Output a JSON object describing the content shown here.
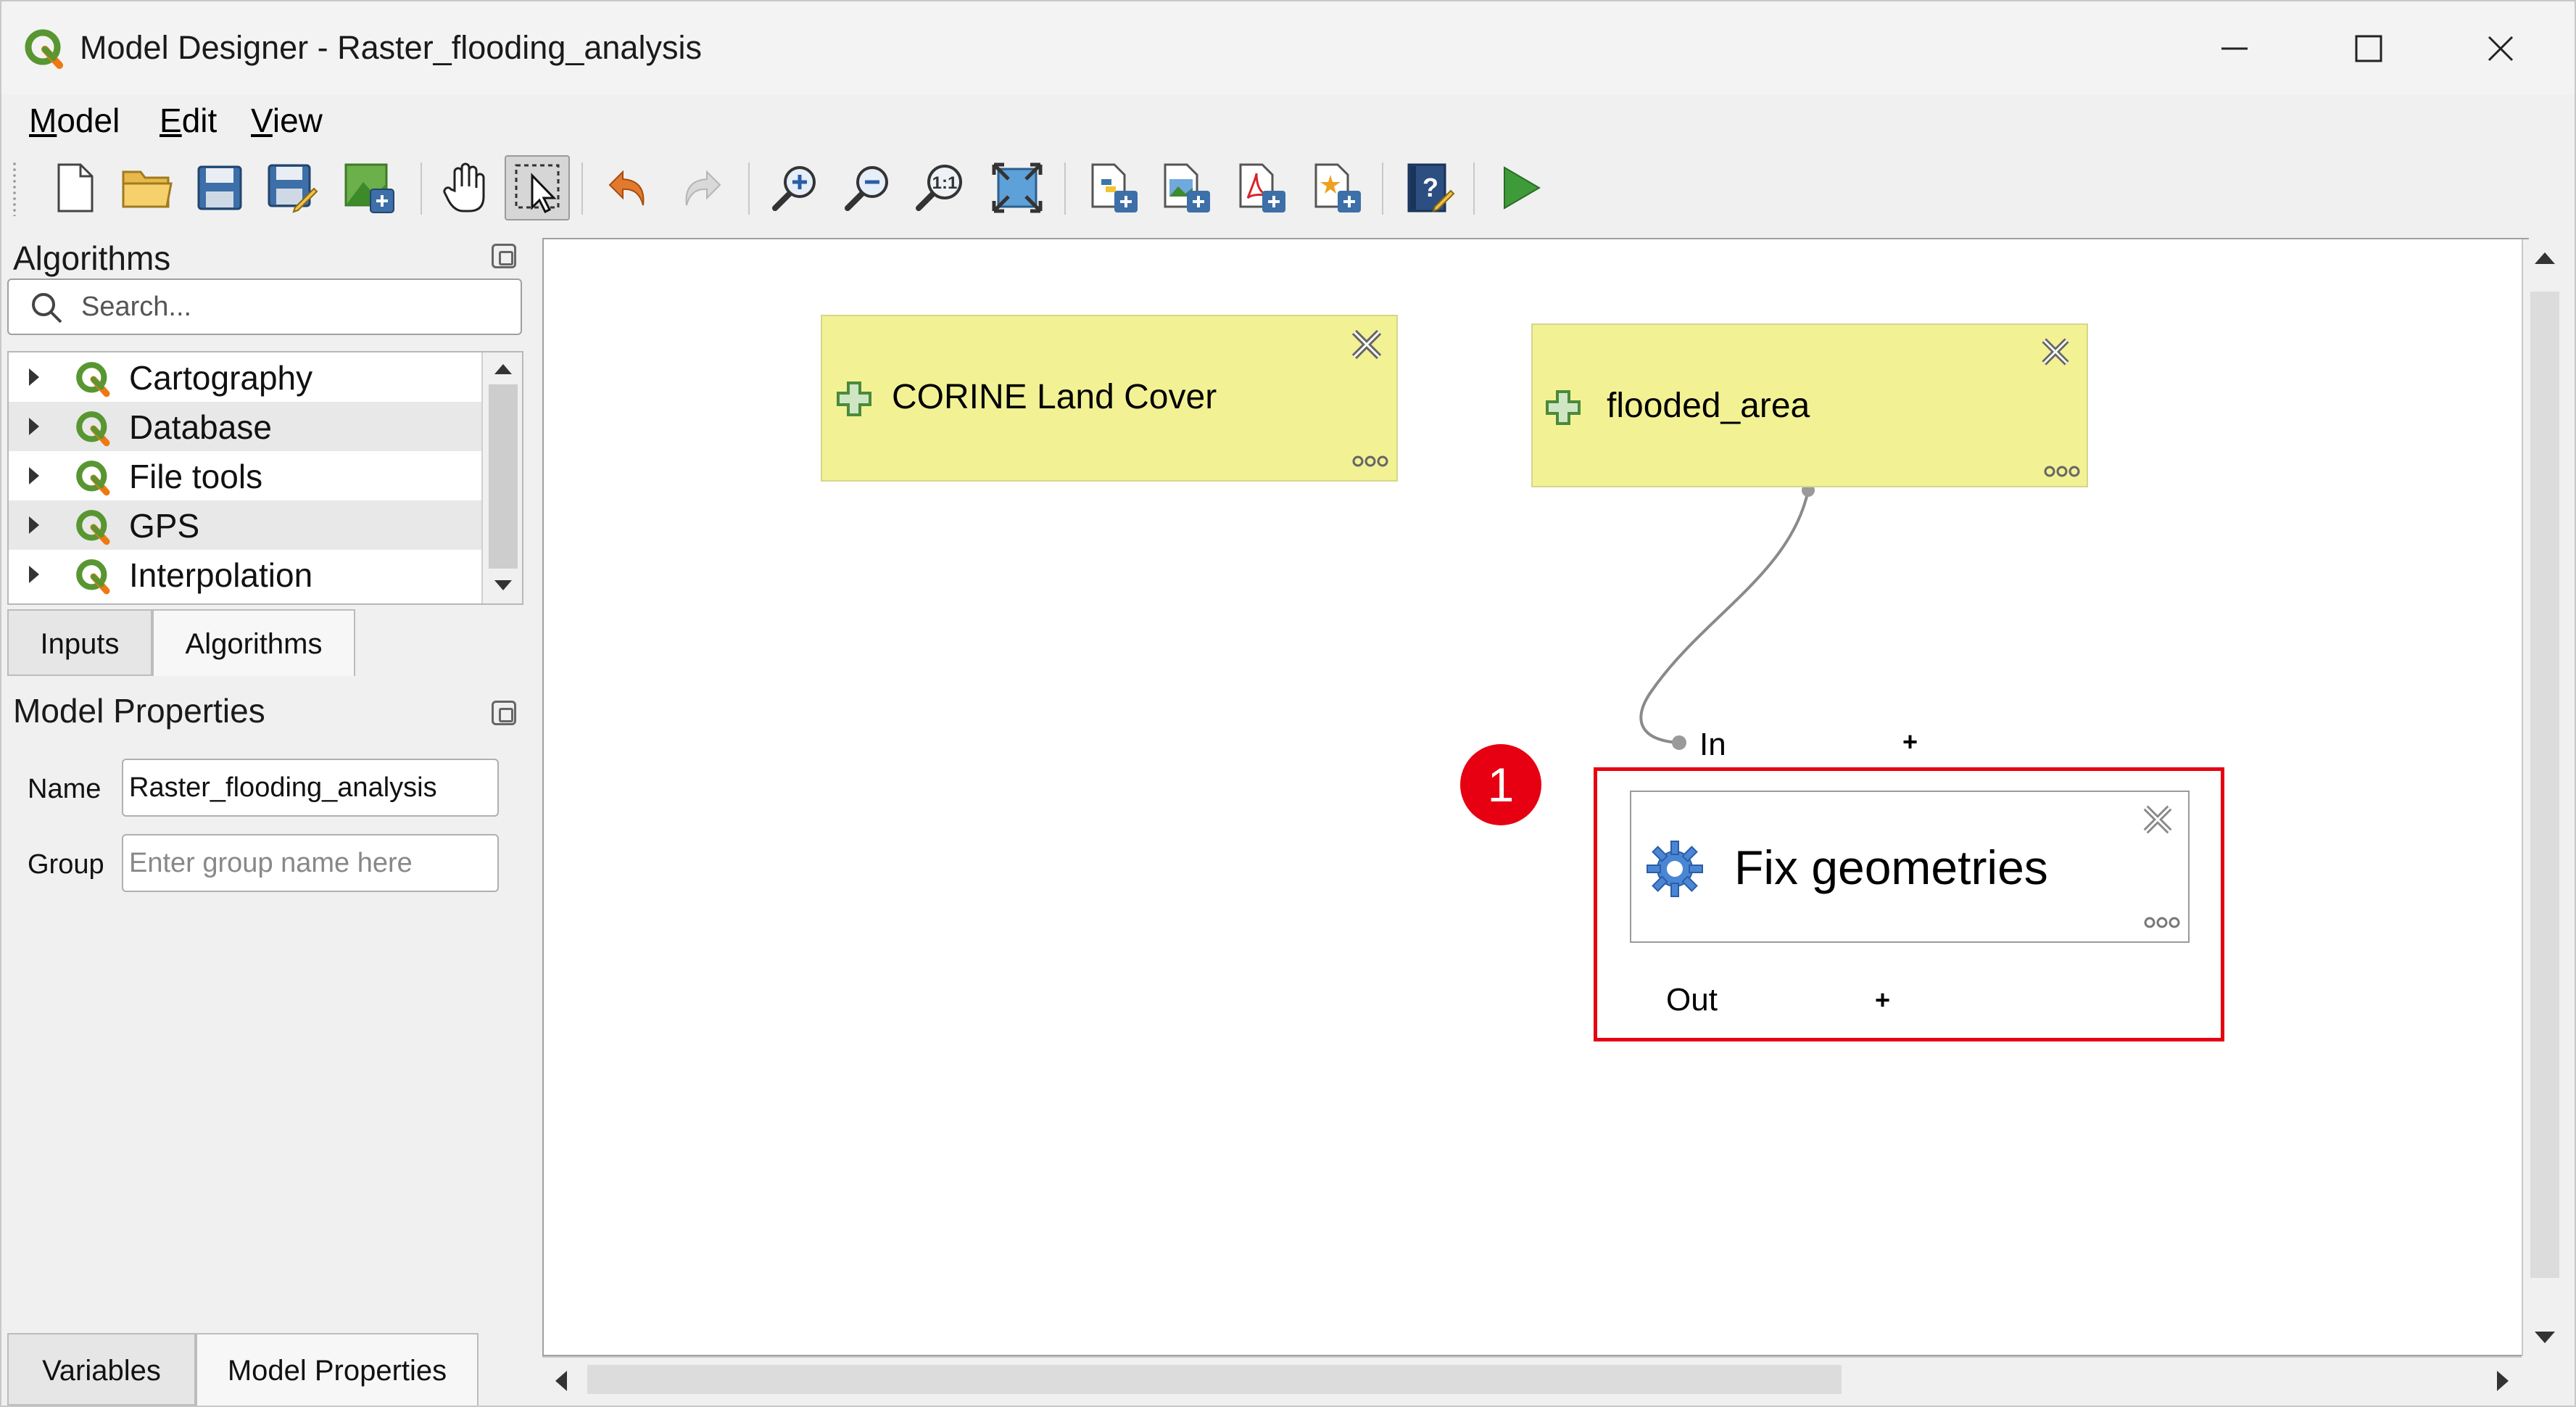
{
  "window": {
    "title": "Model Designer - Raster_flooding_analysis"
  },
  "menu": {
    "model": "Model",
    "model_u": "M",
    "model_rest": "odel",
    "edit_u": "E",
    "edit_rest": "dit",
    "view_u": "V",
    "view_rest": "iew"
  },
  "toolbar": {
    "icons": [
      "new-model-icon",
      "open-model-icon",
      "save-model-icon",
      "save-as-icon",
      "save-in-project-icon",
      "pan-icon",
      "select-icon",
      "undo-icon",
      "redo-icon",
      "zoom-in-icon",
      "zoom-out-icon",
      "zoom-actual-icon",
      "zoom-full-icon",
      "export-python-icon",
      "export-image-icon",
      "export-pdf-icon",
      "export-svg-icon",
      "help-icon",
      "run-model-icon"
    ]
  },
  "algorithms_panel": {
    "title": "Algorithms",
    "search_placeholder": "Search...",
    "items": [
      {
        "label": "Cartography"
      },
      {
        "label": "Database"
      },
      {
        "label": "File tools"
      },
      {
        "label": "GPS"
      },
      {
        "label": "Interpolation"
      }
    ],
    "tabs": [
      "Inputs",
      "Algorithms"
    ]
  },
  "model_properties": {
    "title": "Model Properties",
    "name_label": "Name",
    "name_value": "Raster_flooding_analysis",
    "group_label": "Group",
    "group_placeholder": "Enter group name here"
  },
  "bottom_tabs": [
    "Variables",
    "Model Properties"
  ],
  "canvas": {
    "inputs": [
      {
        "label": "CORINE Land Cover"
      },
      {
        "label": "flooded_area"
      }
    ],
    "algorithm": {
      "label": "Fix geometries",
      "in_port": "In",
      "out_port": "Out"
    },
    "callout_number": "1"
  },
  "colors": {
    "input_node": "#f2f295",
    "highlight": "#e60012",
    "qgis_green": "#589632"
  }
}
